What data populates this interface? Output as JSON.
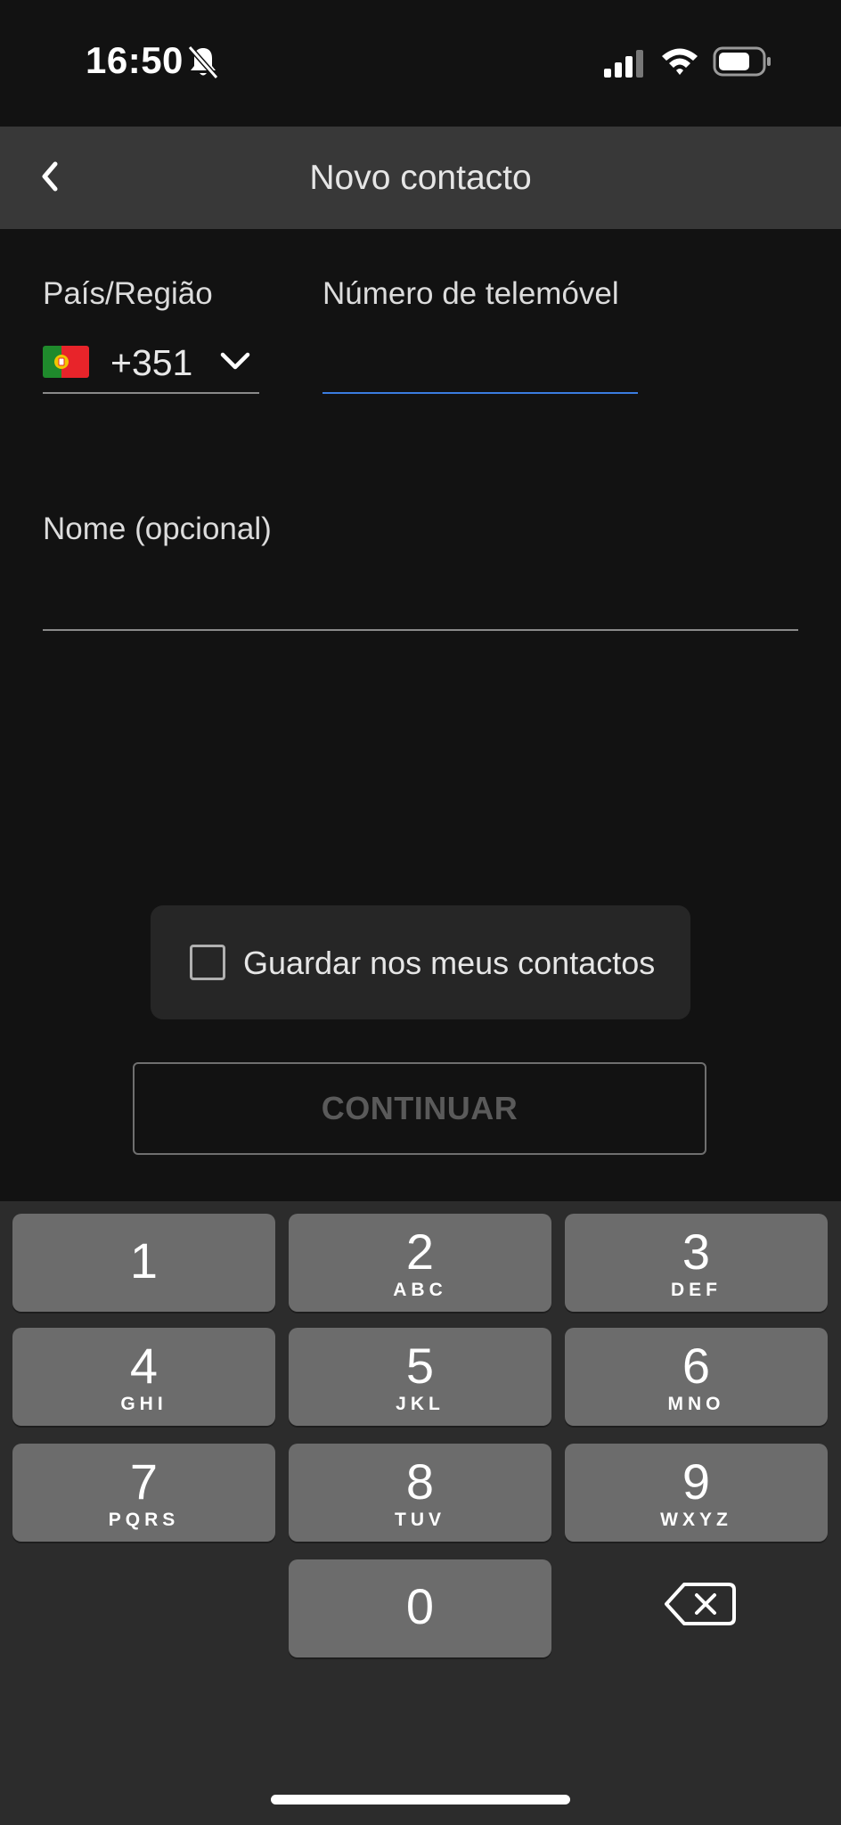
{
  "status_bar": {
    "time": "16:50",
    "icons": [
      "bell-muted-icon",
      "signal-icon",
      "wifi-icon",
      "battery-icon"
    ]
  },
  "nav": {
    "title": "Novo contacto",
    "back_icon": "chevron-left-icon"
  },
  "form": {
    "country_label": "País/Região",
    "country_flag": "flag-portugal-icon",
    "dial_code": "+351",
    "phone_label": "Número de telemóvel",
    "phone_value": "",
    "name_label": "Nome (opcional)",
    "name_value": ""
  },
  "save_contact": {
    "label": "Guardar nos meus contactos",
    "checked": false
  },
  "continue_label": "CONTINUAR",
  "keypad": {
    "keys": [
      {
        "digit": "1",
        "letters": ""
      },
      {
        "digit": "2",
        "letters": "ABC"
      },
      {
        "digit": "3",
        "letters": "DEF"
      },
      {
        "digit": "4",
        "letters": "GHI"
      },
      {
        "digit": "5",
        "letters": "JKL"
      },
      {
        "digit": "6",
        "letters": "MNO"
      },
      {
        "digit": "7",
        "letters": "PQRS"
      },
      {
        "digit": "8",
        "letters": "TUV"
      },
      {
        "digit": "9",
        "letters": "WXYZ"
      },
      {
        "digit": "0",
        "letters": ""
      }
    ],
    "backspace_icon": "backspace-icon"
  },
  "colors": {
    "accent": "#3b7de0",
    "background": "#121212",
    "nav_bar": "#383838",
    "key": "#6c6c6c"
  }
}
